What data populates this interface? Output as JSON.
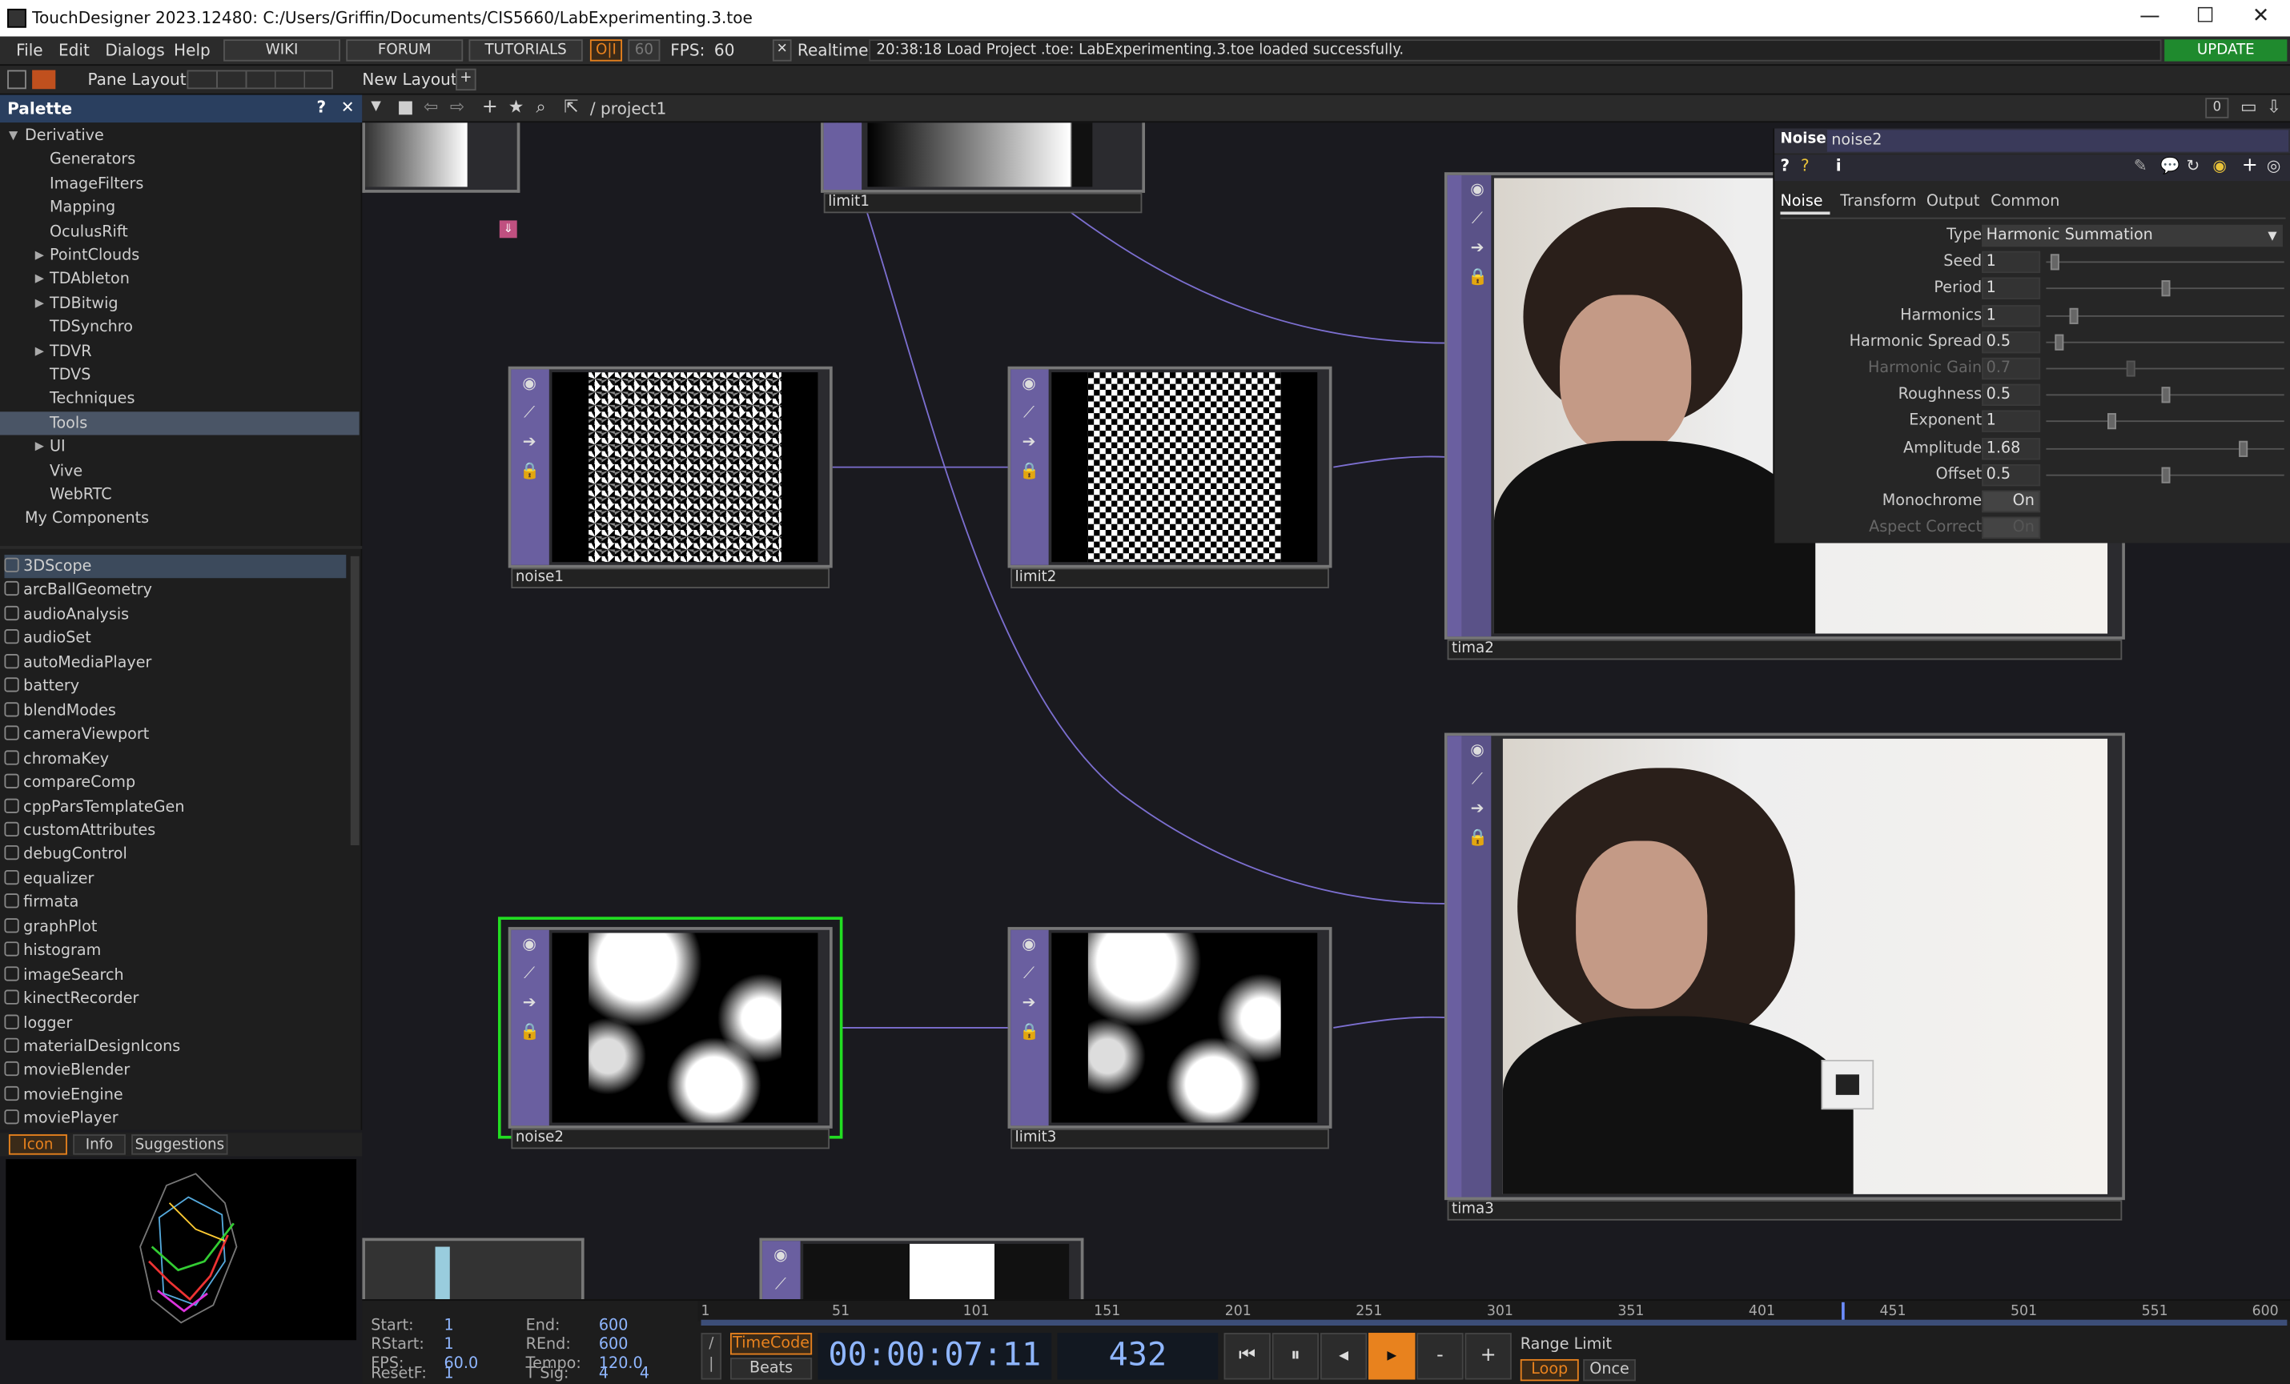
{
  "window": {
    "title": "TouchDesigner 2023.12480: C:/Users/Griffin/Documents/CIS5660/LabExperimenting.3.toe",
    "minimize": "—",
    "maximize": "☐",
    "close": "✕"
  },
  "menu": {
    "items": [
      "File",
      "Edit",
      "Dialogs",
      "Help"
    ],
    "wiki": "WIKI",
    "forum": "FORUM",
    "tutorials": "TUTORIALS",
    "oi": "O|I",
    "fps_box": "60",
    "fps_label": "FPS:",
    "fps_value": "60",
    "realtime": "Realtime",
    "status": "20:38:18 Load Project .toe: LabExperimenting.3.toe loaded successfully.",
    "update": "UPDATE"
  },
  "panebar": {
    "pane_layout": "Pane Layout",
    "new_layout": "New Layout",
    "plus": "+"
  },
  "palette": {
    "title": "Palette",
    "help": "?",
    "close": "✕",
    "tree": [
      {
        "label": "Derivative",
        "level": 0,
        "open": true
      },
      {
        "label": "Generators",
        "level": 1
      },
      {
        "label": "ImageFilters",
        "level": 1
      },
      {
        "label": "Mapping",
        "level": 1
      },
      {
        "label": "OculusRift",
        "level": 1
      },
      {
        "label": "PointClouds",
        "level": 1,
        "arrow": true
      },
      {
        "label": "TDAbleton",
        "level": 1,
        "arrow": true
      },
      {
        "label": "TDBitwig",
        "level": 1,
        "arrow": true
      },
      {
        "label": "TDSynchro",
        "level": 1
      },
      {
        "label": "TDVR",
        "level": 1,
        "arrow": true
      },
      {
        "label": "TDVS",
        "level": 1
      },
      {
        "label": "Techniques",
        "level": 1
      },
      {
        "label": "Tools",
        "level": 1,
        "selected": true
      },
      {
        "label": "UI",
        "level": 1,
        "arrow": true
      },
      {
        "label": "Vive",
        "level": 1
      },
      {
        "label": "WebRTC",
        "level": 1
      },
      {
        "label": "My Components",
        "level": 0
      }
    ],
    "items": [
      "3DScope",
      "arcBallGeometry",
      "audioAnalysis",
      "audioSet",
      "autoMediaPlayer",
      "battery",
      "blendModes",
      "cameraViewport",
      "chromaKey",
      "compareComp",
      "cppParsTemplateGen",
      "customAttributes",
      "debugControl",
      "equalizer",
      "firmata",
      "graphPlot",
      "histogram",
      "imageSearch",
      "kinectRecorder",
      "logger",
      "materialDesignIcons",
      "movieBlender",
      "movieEngine",
      "moviePlayer"
    ],
    "tabs": [
      "Icon",
      "Info",
      "Suggestions"
    ]
  },
  "network": {
    "path": "/ project1",
    "counter": "0",
    "nodes": [
      {
        "name": "limit1"
      },
      {
        "name": "noise1"
      },
      {
        "name": "limit2"
      },
      {
        "name": "tima2"
      },
      {
        "name": "noise2"
      },
      {
        "name": "limit3"
      },
      {
        "name": "tima3"
      }
    ]
  },
  "params": {
    "op_type": "Noise",
    "op_name": "noise2",
    "tabs": [
      "Noise",
      "Transform",
      "Output",
      "Common"
    ],
    "rows": [
      {
        "label": "Type",
        "value": "Harmonic Summation",
        "kind": "menu"
      },
      {
        "label": "Seed",
        "value": "1",
        "slider": 0.02
      },
      {
        "label": "Period",
        "value": "1",
        "slider": 0.5
      },
      {
        "label": "Harmonics",
        "value": "1",
        "slider": 0.1
      },
      {
        "label": "Harmonic Spread",
        "value": "0.5",
        "slider": 0.04
      },
      {
        "label": "Harmonic Gain",
        "value": "0.7",
        "slider": 0.35,
        "dim": true
      },
      {
        "label": "Roughness",
        "value": "0.5",
        "slider": 0.5
      },
      {
        "label": "Exponent",
        "value": "1",
        "slider": 0.27
      },
      {
        "label": "Amplitude",
        "value": "1.68",
        "slider": 0.84
      },
      {
        "label": "Offset",
        "value": "0.5",
        "slider": 0.5
      },
      {
        "label": "Monochrome",
        "value": "On",
        "kind": "toggle"
      },
      {
        "label": "Aspect Correct",
        "value": "On",
        "kind": "toggle",
        "dim": true
      }
    ]
  },
  "timeline": {
    "start_label": "Start:",
    "start": "1",
    "end_label": "End:",
    "end": "600",
    "rstart_label": "RStart:",
    "rstart": "1",
    "rend_label": "REnd:",
    "rend": "600",
    "fps_label": "FPS:",
    "fps": "60.0",
    "tempo_label": "Tempo:",
    "tempo": "120.0",
    "resetf_label": "ResetF:",
    "resetf": "1",
    "tsig_label": "T Sig:",
    "tsig_a": "4",
    "tsig_b": "4",
    "ruler": [
      "1",
      "51",
      "101",
      "151",
      "201",
      "251",
      "301",
      "351",
      "401",
      "451",
      "501",
      "551",
      "600"
    ],
    "timecode_label": "TimeCode",
    "beats_label": "Beats",
    "timecode": "00:00:07:11",
    "frame": "432",
    "range_limit": "Range Limit",
    "loop": "Loop",
    "once": "Once",
    "playhead_fraction": 0.7196
  },
  "colors": {
    "accent": "#e8821e",
    "node_purple": "#6a5fa0",
    "selected_green": "#22dd22",
    "update_green": "#1f8a2e",
    "palette_header": "#2a3f5f"
  }
}
